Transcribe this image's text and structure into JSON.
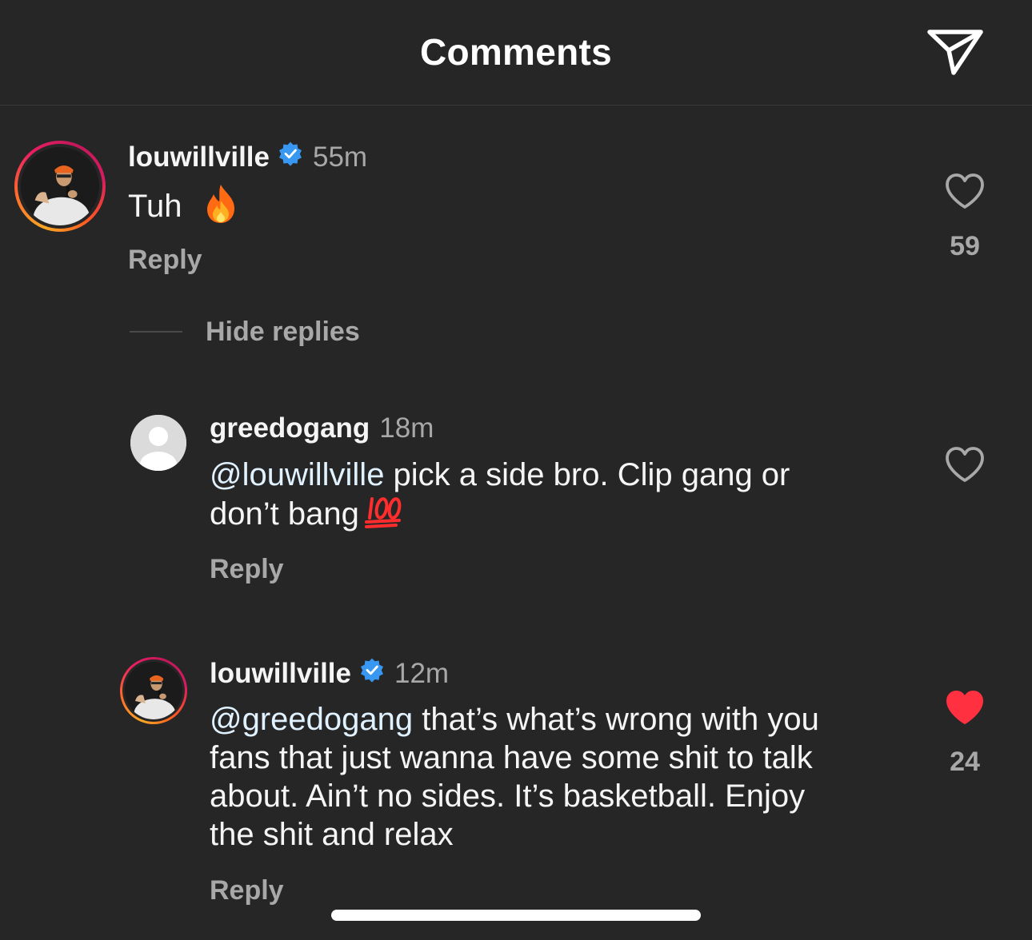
{
  "header": {
    "title": "Comments",
    "send_icon": "paper-plane-icon"
  },
  "comments": [
    {
      "username": "louwillville",
      "verified": true,
      "time": "55m",
      "text": "Tuh",
      "emoji": "fire",
      "reply_label": "Reply",
      "like_count": "59",
      "liked": false
    }
  ],
  "thread": {
    "hide_replies_label": "Hide replies"
  },
  "replies": [
    {
      "username": "greedogang",
      "verified": false,
      "time": "18m",
      "mention": "@louwillville",
      "text_line1": " pick a side bro. Clip gang or",
      "text_line2": "don’t bang",
      "emoji": "hundred-points",
      "reply_label": "Reply",
      "liked": false
    },
    {
      "username": "louwillville",
      "verified": true,
      "time": "12m",
      "mention": "@greedogang",
      "text_line1": " that’s what’s wrong with you",
      "text_line2": "fans that just wanna have some shit to talk",
      "text_line3": "about. Ain’t no sides. It’s basketball. Enjoy",
      "text_line4": "the shit and relax",
      "reply_label": "Reply",
      "like_count": "24",
      "liked": true
    }
  ],
  "colors": {
    "background": "#262626",
    "secondary_text": "#a8a8a8",
    "verified_blue": "#3897f0",
    "liked_red": "#ff3040"
  }
}
